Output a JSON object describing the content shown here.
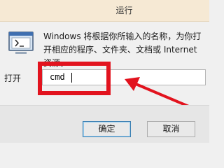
{
  "window": {
    "title": "运行"
  },
  "description": "Windows 将根据你所输入的名称，为你打开相应的程序、文件夹、文档或 Internet 资源。",
  "open_field": {
    "label": "打开",
    "value": "cmd"
  },
  "buttons": {
    "ok": "确定",
    "cancel": "取消"
  },
  "colors": {
    "annotation": "#e2131e",
    "titlebar": "#f6e9d4"
  },
  "icons": {
    "run": "run-window-icon",
    "annotation_arrow": "red-arrow-annotation"
  }
}
